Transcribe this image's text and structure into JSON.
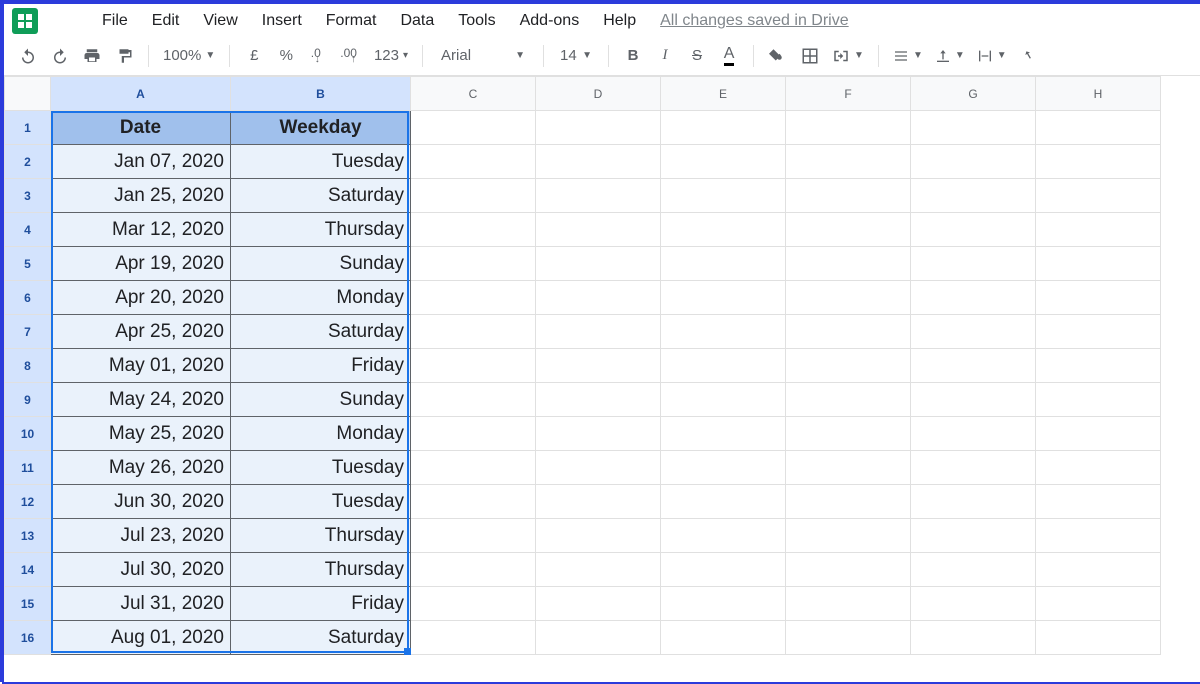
{
  "menubar": {
    "items": [
      "File",
      "Edit",
      "View",
      "Insert",
      "Format",
      "Data",
      "Tools",
      "Add-ons",
      "Help"
    ],
    "save_status": "All changes saved in Drive"
  },
  "toolbar": {
    "zoom": "100%",
    "currency_symbol": "£",
    "percent": "%",
    "dec_less": ".0",
    "dec_more": ".00",
    "more_formats": "123",
    "font": "Arial",
    "font_size": "14",
    "bold": "B",
    "italic": "I",
    "strike": "S",
    "text_color": "A"
  },
  "columns": [
    "A",
    "B",
    "C",
    "D",
    "E",
    "F",
    "G",
    "H"
  ],
  "header_row": {
    "date": "Date",
    "weekday": "Weekday"
  },
  "rows": [
    {
      "date": "Jan 07, 2020",
      "weekday": "Tuesday"
    },
    {
      "date": "Jan 25, 2020",
      "weekday": "Saturday"
    },
    {
      "date": "Mar 12, 2020",
      "weekday": "Thursday"
    },
    {
      "date": "Apr 19, 2020",
      "weekday": "Sunday"
    },
    {
      "date": "Apr 20, 2020",
      "weekday": "Monday"
    },
    {
      "date": "Apr 25, 2020",
      "weekday": "Saturday"
    },
    {
      "date": "May 01, 2020",
      "weekday": "Friday"
    },
    {
      "date": "May 24, 2020",
      "weekday": "Sunday"
    },
    {
      "date": "May 25, 2020",
      "weekday": "Monday"
    },
    {
      "date": "May 26, 2020",
      "weekday": "Tuesday"
    },
    {
      "date": "Jun 30, 2020",
      "weekday": "Tuesday"
    },
    {
      "date": "Jul 23, 2020",
      "weekday": "Thursday"
    },
    {
      "date": "Jul 30, 2020",
      "weekday": "Thursday"
    },
    {
      "date": "Jul 31, 2020",
      "weekday": "Friday"
    },
    {
      "date": "Aug 01, 2020",
      "weekday": "Saturday"
    }
  ]
}
